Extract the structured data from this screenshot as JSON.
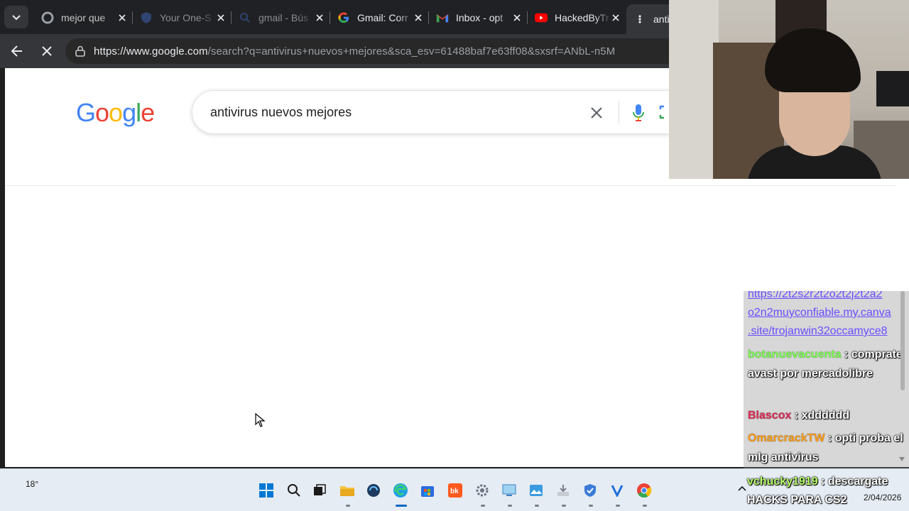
{
  "tabs": [
    {
      "title": "mejor que",
      "favicon": "google-g-icon"
    },
    {
      "title": "Your One-S",
      "favicon": "shield-icon"
    },
    {
      "title": "gmail - Bús",
      "favicon": "search-icon"
    },
    {
      "title": "Gmail: Corr",
      "favicon": "google-g-icon"
    },
    {
      "title": "Inbox - opt",
      "favicon": "gmail-icon"
    },
    {
      "title": "HackedByTr",
      "favicon": "youtube-icon"
    },
    {
      "title": "anti",
      "favicon": "loading-icon"
    }
  ],
  "omnibox": {
    "url_host": "https://www.google.com",
    "url_path": "/search?q=antivirus+nuevos+mejores&sca_esv=61488baf7e63ff08&sxsrf=ANbL-n5M"
  },
  "page": {
    "logo_text": "Google",
    "query": "antivirus nuevos mejores"
  },
  "colors": {
    "google_blue": "#4285F4",
    "google_red": "#EA4335",
    "google_yellow": "#FBBC05",
    "google_green": "#34A853",
    "chrome_dark": "#202124"
  },
  "chat": {
    "link_lines": [
      "https://2t2s2r2t2o2t2j2t2a2",
      "o2n2muyconfiable.my.canva",
      ".site/trojanwin32occamyce8"
    ],
    "messages": [
      {
        "user": "botanuevacuenta",
        "user_color": "#7cff52",
        "text": "comprate avast por mercadolibre"
      },
      {
        "user": "Blascox",
        "user_color": "#e0305a",
        "text": "xdddddd"
      },
      {
        "user": "OmarcrackTW",
        "user_color": "#ff9f1a",
        "text": "opti proba el mlg antivirus"
      },
      {
        "user": "vchucky1919",
        "user_color": "#b8ff66",
        "text": "descargate HACKS PARA CS2"
      }
    ],
    "separator": " : "
  },
  "taskbar": {
    "weather": "18°",
    "date_fragment": "2/04/2026",
    "apps": [
      "start-icon",
      "search-icon",
      "task-view-icon",
      "file-explorer-icon",
      "app-sync-icon",
      "edge-icon",
      "store-icon",
      "bk-icon",
      "settings-icon",
      "control-panel-icon",
      "photos-icon",
      "installer-icon",
      "defender-icon",
      "vpn-icon",
      "chrome-icon"
    ]
  }
}
